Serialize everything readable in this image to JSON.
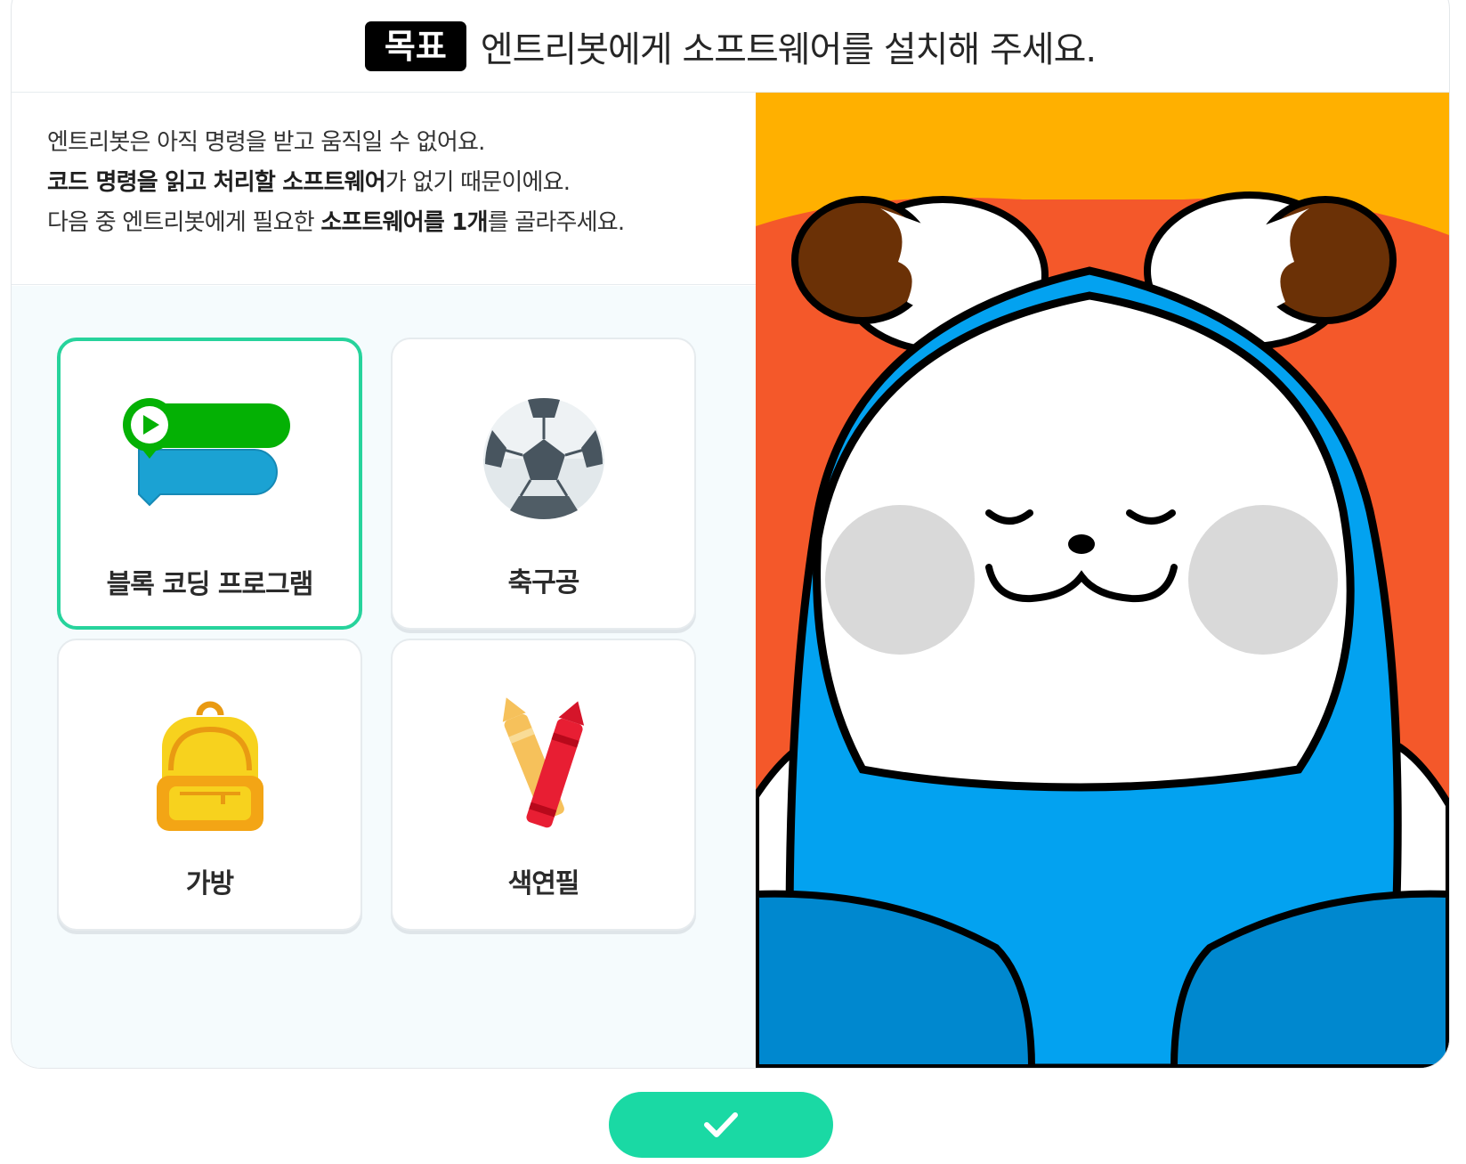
{
  "goal": {
    "badge": "목표",
    "text": "엔트리봇에게 소프트웨어를 설치해 주세요."
  },
  "description": {
    "line1": "엔트리봇은 아직 명령을 받고 움직일 수 없어요.",
    "line2_bold": "코드 명령을 읽고 처리할 소프트웨어",
    "line2_rest": "가 없기 때문이에요.",
    "line3_pre": "다음 중 엔트리봇에게 필요한 ",
    "line3_bold": "소프트웨어를 1개",
    "line3_post": "를 골라주세요."
  },
  "options": [
    {
      "label": "블록 코딩 프로그램",
      "icon": "block-coding-icon",
      "selected": true
    },
    {
      "label": "축구공",
      "icon": "soccer-ball-icon",
      "selected": false
    },
    {
      "label": "가방",
      "icon": "backpack-icon",
      "selected": false
    },
    {
      "label": "색연필",
      "icon": "crayons-icon",
      "selected": false
    }
  ],
  "confirm": {
    "icon": "check-icon"
  },
  "colors": {
    "accent": "#1ad9a4",
    "selected_border": "#27d39c",
    "illustration_bg_top": "#ffb000",
    "illustration_bg": "#f4582a",
    "character_hood": "#03a2f0"
  }
}
